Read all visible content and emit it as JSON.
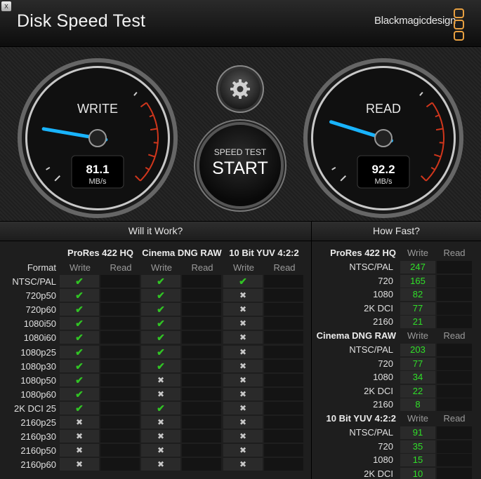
{
  "window": {
    "title": "Disk Speed Test",
    "brand": "Blackmagicdesign",
    "close_glyph": "x"
  },
  "settings": {
    "icon": "gear-icon"
  },
  "start_button": {
    "small": "SPEED TEST",
    "big": "START"
  },
  "write_gauge": {
    "label": "WRITE",
    "value": "81.1",
    "unit": "MB/s",
    "reading": 81.1
  },
  "read_gauge": {
    "label": "READ",
    "value": "92.2",
    "unit": "MB/s",
    "reading": 92.2
  },
  "will_it_work": {
    "title": "Will it Work?",
    "format_label": "Format",
    "groups": [
      {
        "name": "ProRes 422 HQ",
        "write": "Write",
        "read": "Read"
      },
      {
        "name": "Cinema DNG RAW",
        "write": "Write",
        "read": "Read"
      },
      {
        "name": "10 Bit YUV 4:2:2",
        "write": "Write",
        "read": "Read"
      }
    ],
    "rows": [
      {
        "format": "NTSC/PAL",
        "marks": [
          true,
          true,
          true
        ]
      },
      {
        "format": "720p50",
        "marks": [
          true,
          true,
          false
        ]
      },
      {
        "format": "720p60",
        "marks": [
          true,
          true,
          false
        ]
      },
      {
        "format": "1080i50",
        "marks": [
          true,
          true,
          false
        ]
      },
      {
        "format": "1080i60",
        "marks": [
          true,
          true,
          false
        ]
      },
      {
        "format": "1080p25",
        "marks": [
          true,
          true,
          false
        ]
      },
      {
        "format": "1080p30",
        "marks": [
          true,
          true,
          false
        ]
      },
      {
        "format": "1080p50",
        "marks": [
          true,
          false,
          false
        ]
      },
      {
        "format": "1080p60",
        "marks": [
          true,
          false,
          false
        ]
      },
      {
        "format": "2K DCI 25",
        "marks": [
          true,
          true,
          false
        ]
      },
      {
        "format": "2160p25",
        "marks": [
          false,
          false,
          false
        ]
      },
      {
        "format": "2160p30",
        "marks": [
          false,
          false,
          false
        ]
      },
      {
        "format": "2160p50",
        "marks": [
          false,
          false,
          false
        ]
      },
      {
        "format": "2160p60",
        "marks": [
          false,
          false,
          false
        ]
      }
    ]
  },
  "how_fast": {
    "title": "How Fast?",
    "sections": [
      {
        "name": "ProRes 422 HQ",
        "write": "Write",
        "read": "Read",
        "rows": [
          {
            "format": "NTSC/PAL",
            "fps": "247"
          },
          {
            "format": "720",
            "fps": "165"
          },
          {
            "format": "1080",
            "fps": "82"
          },
          {
            "format": "2K DCI",
            "fps": "77"
          },
          {
            "format": "2160",
            "fps": "21"
          }
        ]
      },
      {
        "name": "Cinema DNG RAW",
        "write": "Write",
        "read": "Read",
        "rows": [
          {
            "format": "NTSC/PAL",
            "fps": "203"
          },
          {
            "format": "720",
            "fps": "77"
          },
          {
            "format": "1080",
            "fps": "34"
          },
          {
            "format": "2K DCI",
            "fps": "22"
          },
          {
            "format": "2160",
            "fps": "8"
          }
        ]
      },
      {
        "name": "10 Bit YUV 4:2:2",
        "write": "Write",
        "read": "Read",
        "rows": [
          {
            "format": "NTSC/PAL",
            "fps": "91"
          },
          {
            "format": "720",
            "fps": "35"
          },
          {
            "format": "1080",
            "fps": "15"
          },
          {
            "format": "2K DCI",
            "fps": "10"
          }
        ]
      }
    ]
  },
  "colors": {
    "needle": "#19b4ff",
    "ok": "#31c424",
    "fps": "#30e028",
    "brand_accent": "#e8a040",
    "redline": "#d0361c"
  }
}
